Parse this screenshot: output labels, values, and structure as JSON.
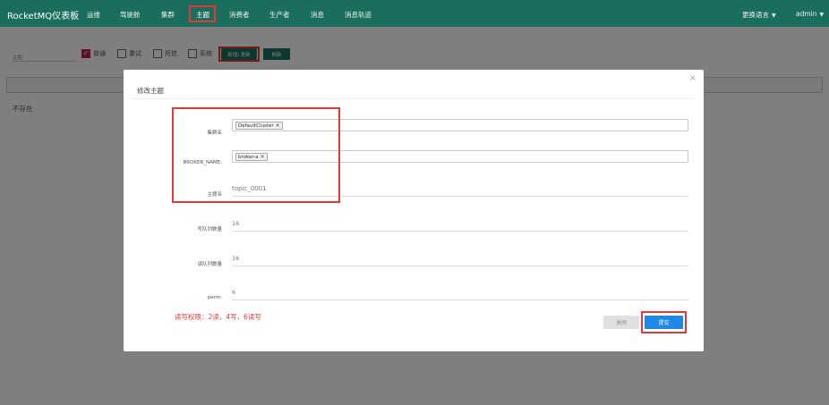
{
  "navbar": {
    "brand": "RocketMQ仪表板",
    "items": [
      "运维",
      "驾驶舱",
      "集群",
      "主题",
      "消费者",
      "生产者",
      "消息",
      "消息轨迹"
    ],
    "language": "更换语言",
    "user": "admin",
    "active_item": "主题",
    "bg_color": "#1b6e5e"
  },
  "filter": {
    "label": "主题",
    "checkboxes": [
      {
        "label": "普通",
        "checked": true
      },
      {
        "label": "重试",
        "checked": false
      },
      {
        "label": "死信",
        "checked": false
      },
      {
        "label": "系统",
        "checked": false
      }
    ],
    "add_update_button": "新增/ 更新",
    "refresh_button": "刷新"
  },
  "page": {
    "empty_text": "不存在"
  },
  "modal": {
    "title": "修改主题",
    "close_icon": "×",
    "fields": {
      "cluster_label": "集群名",
      "cluster_tag": "DefaultCluster",
      "broker_label": "BROKER_NAME:",
      "broker_tag": "broker-a",
      "topic_label": "主题名",
      "topic_value": "topic_0001",
      "write_queue_label": "写队列数量",
      "write_queue_value": "16",
      "read_queue_label": "读队列数量",
      "read_queue_value": "16",
      "perm_label": "perm:",
      "perm_value": "6"
    },
    "note": "读写权限：2读，4写，6读写",
    "close_button": "关闭",
    "submit_button": "提交",
    "submit_color": "#1e88e5",
    "highlight_color": "#e53935"
  }
}
